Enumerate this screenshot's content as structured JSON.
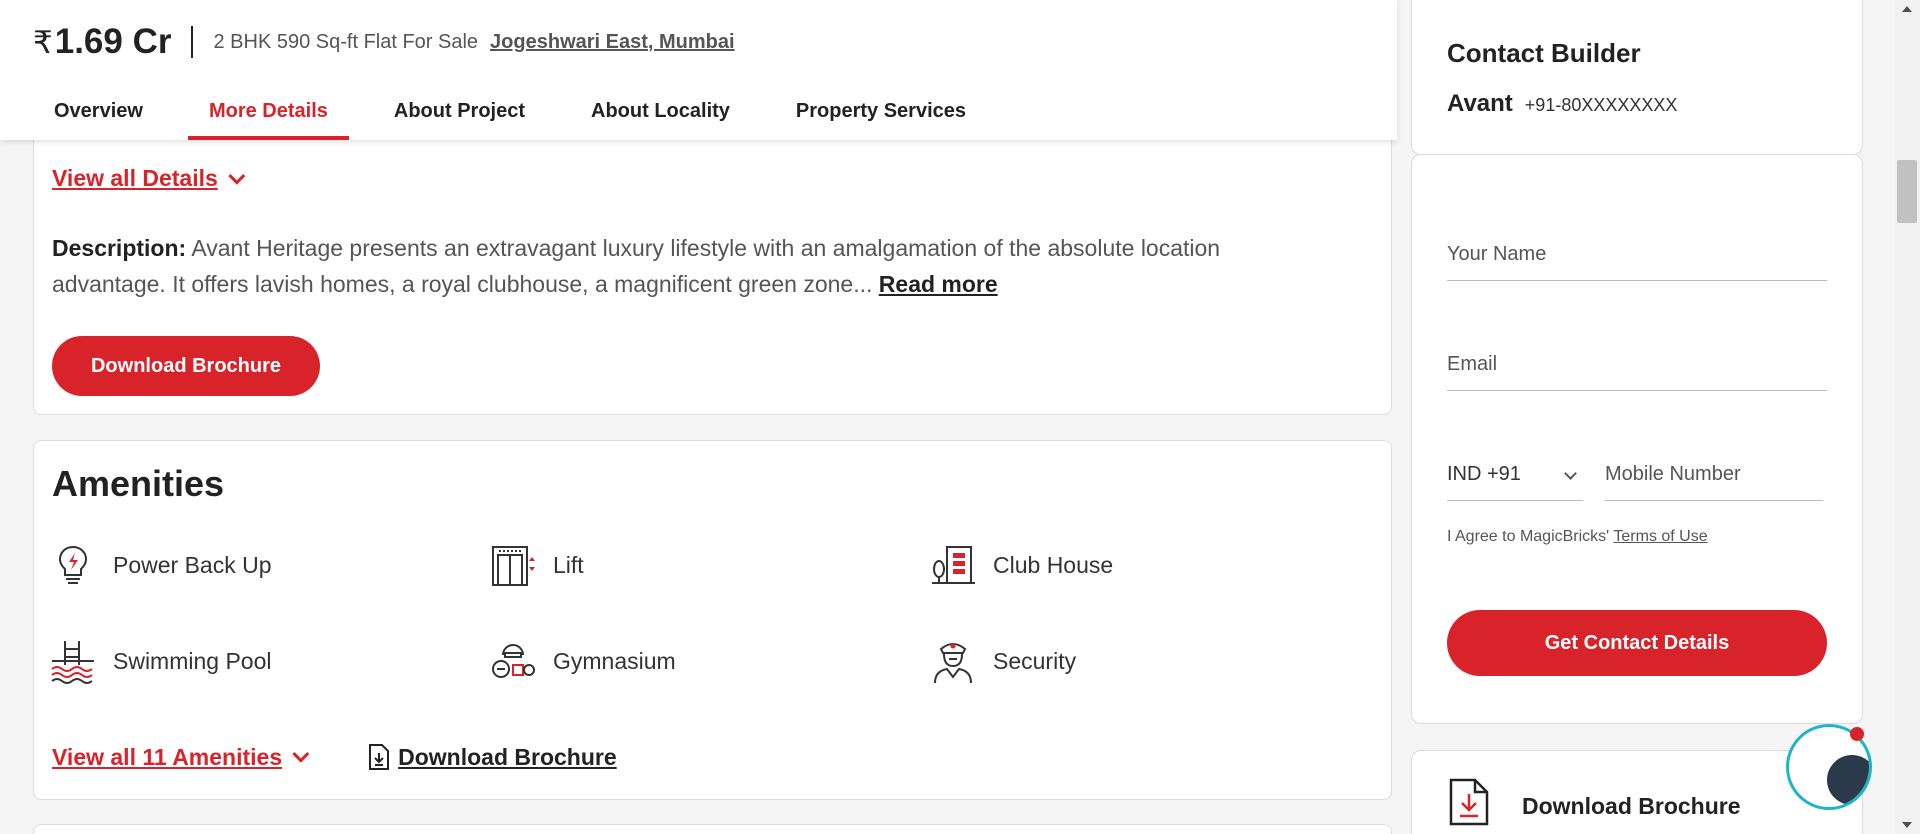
{
  "header": {
    "currency_symbol": "₹",
    "price": "1.69 Cr",
    "subtitle": "2 BHK 590 Sq-ft Flat For Sale",
    "location": "Jogeshwari East, Mumbai",
    "tabs": [
      {
        "label": "Overview",
        "active": false
      },
      {
        "label": "More Details",
        "active": true
      },
      {
        "label": "About Project",
        "active": false
      },
      {
        "label": "About Locality",
        "active": false
      },
      {
        "label": "Property Services",
        "active": false
      }
    ]
  },
  "details": {
    "view_all_label": "View all Details",
    "description_label": "Description:",
    "description_text": "Avant Heritage presents an extravagant luxury lifestyle with an amalgamation of the absolute location advantage. It offers lavish homes, a royal clubhouse, a magnificent green zone...",
    "read_more": "Read more",
    "download_button": "Download Brochure"
  },
  "amenities": {
    "title": "Amenities",
    "items": [
      {
        "label": "Power Back Up",
        "icon": "power-backup-icon"
      },
      {
        "label": "Lift",
        "icon": "lift-icon"
      },
      {
        "label": "Club House",
        "icon": "club-house-icon"
      },
      {
        "label": "Swimming Pool",
        "icon": "swimming-pool-icon"
      },
      {
        "label": "Gymnasium",
        "icon": "gymnasium-icon"
      },
      {
        "label": "Security",
        "icon": "security-icon"
      }
    ],
    "view_all_label": "View all 11 Amenities",
    "download_label": "Download Brochure"
  },
  "contact": {
    "title": "Contact Builder",
    "builder_name": "Avant",
    "builder_phone": "+91-80XXXXXXXX"
  },
  "form": {
    "name_placeholder": "Your Name",
    "email_placeholder": "Email",
    "country_code": "IND +91",
    "mobile_placeholder": "Mobile Number",
    "terms_prefix": "I Agree to MagicBricks'",
    "terms_link": "Terms of Use",
    "submit_label": "Get Contact Details"
  },
  "download_card": {
    "label": "Download Brochure"
  },
  "colors": {
    "accent": "#d8232a",
    "chat_ring": "#1fb5c9"
  }
}
